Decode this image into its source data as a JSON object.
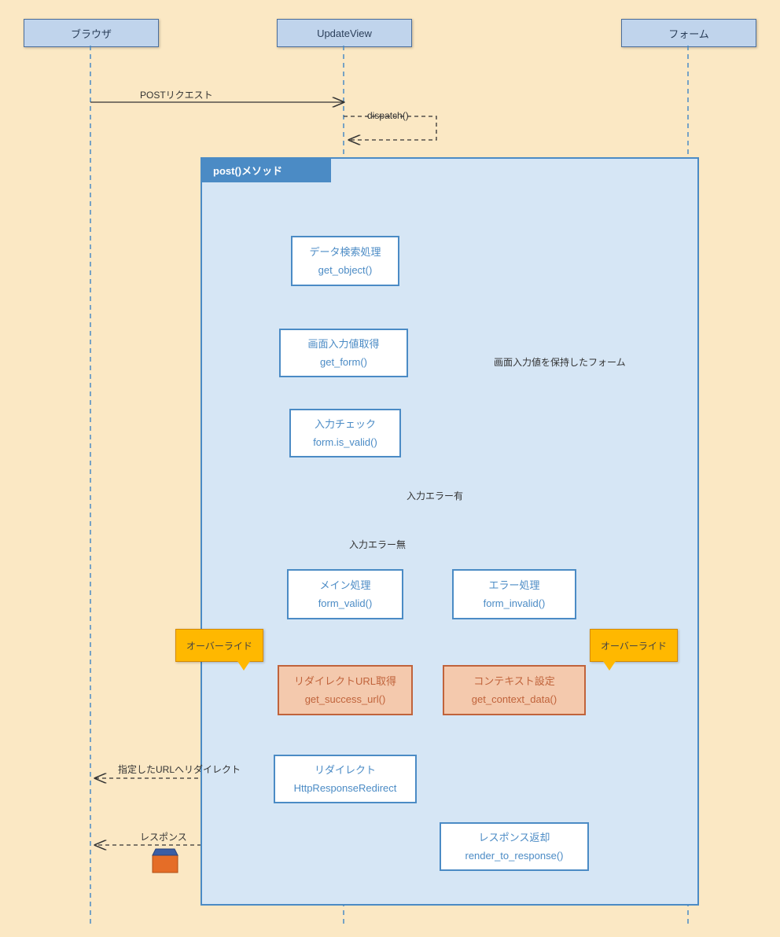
{
  "actors": {
    "browser": "ブラウザ",
    "updateview": "UpdateView",
    "form": "フォーム"
  },
  "method": "post()メソッド",
  "msgs": {
    "postreq": "POSTリクエスト",
    "dispatch": "dispatch()",
    "screenform": "画面入力値を保持したフォーム",
    "err_yes": "入力エラー有",
    "err_no": "入力エラー無",
    "redirect_lbl": "指定したURLへリダイレクト",
    "response": "レスポンス",
    "override": "オーバーライド"
  },
  "b": {
    "getobj": {
      "t": "データ検索処理",
      "m": "get_object()"
    },
    "getform": {
      "t": "画面入力値取得",
      "m": "get_form()"
    },
    "isvalid": {
      "t": "入力チェック",
      "m": "form.is_valid()"
    },
    "fvalid": {
      "t": "メイン処理",
      "m": "form_valid()"
    },
    "finvalid": {
      "t": "エラー処理",
      "m": "form_invalid()"
    },
    "success": {
      "t": "リダイレクトURL取得",
      "m": "get_success_url()"
    },
    "context": {
      "t": "コンテキスト設定",
      "m": "get_context_data()"
    },
    "redirect": {
      "t": "リダイレクト",
      "m": "HttpResponseRedirect"
    },
    "render": {
      "t": "レスポンス返却",
      "m": "render_to_response()"
    }
  }
}
